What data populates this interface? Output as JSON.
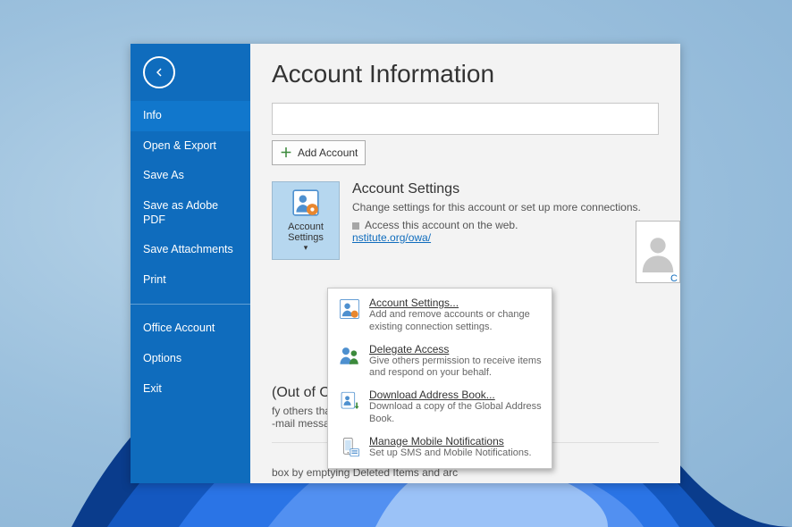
{
  "sidebar": {
    "items": [
      {
        "label": "Info",
        "selected": true
      },
      {
        "label": "Open & Export"
      },
      {
        "label": "Save As"
      },
      {
        "label": "Save as Adobe PDF"
      },
      {
        "label": "Save Attachments"
      },
      {
        "label": "Print"
      }
    ],
    "items2": [
      {
        "label": "Office Account"
      },
      {
        "label": "Options"
      },
      {
        "label": "Exit"
      }
    ]
  },
  "page": {
    "title": "Account Information",
    "add_account_label": "Add Account"
  },
  "account_settings": {
    "button_label": "Account Settings",
    "heading": "Account Settings",
    "desc": "Change settings for this account or set up more connections.",
    "bullet_text": "Access this account on the web.",
    "link_text": "nstitute.org/owa/"
  },
  "profile": {
    "change_label": "C"
  },
  "dropdown": [
    {
      "title": "Account Settings...",
      "desc": "Add and remove accounts or change existing connection settings.",
      "name": "dd-account-settings"
    },
    {
      "title": "Delegate Access",
      "desc": "Give others permission to receive items and respond on your behalf.",
      "name": "dd-delegate-access"
    },
    {
      "title": "Download Address Book...",
      "desc": "Download a copy of the Global Address Book.",
      "name": "dd-download-address-book"
    },
    {
      "title": "Manage Mobile Notifications",
      "desc": "Set up SMS and Mobile Notifications.",
      "name": "dd-manage-mobile-notifications"
    }
  ],
  "ooo": {
    "heading": "(Out of Office)",
    "line1": "fy others that you are out of office, on v",
    "line2": "-mail messages."
  },
  "cleanup": {
    "text": "box by emptying Deleted Items and arc"
  }
}
